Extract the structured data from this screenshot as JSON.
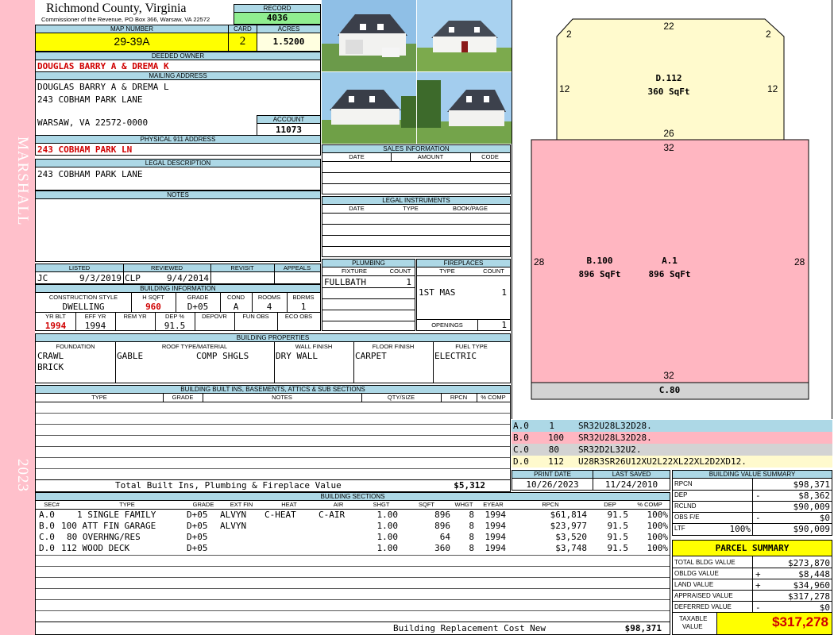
{
  "side_label": "MARSHALL",
  "side_year": "2023",
  "county": "Richmond County, Virginia",
  "commissioner": "Commissioner of the Revenue, PO Box 366, Warsaw, VA 22572",
  "record": {
    "label": "RECORD",
    "value": "4036"
  },
  "map_number": {
    "label": "MAP NUMBER",
    "value": "29-39A"
  },
  "card": {
    "label": "CARD",
    "value": "2"
  },
  "acres": {
    "label": "ACRES",
    "value": "1.5200"
  },
  "deeded_owner": {
    "label": "DEEDED OWNER",
    "value": "DOUGLAS BARRY A & DREMA K"
  },
  "mailing": {
    "label": "MAILING ADDRESS",
    "line1": "DOUGLAS BARRY A & DREMA L",
    "line2": "243 COBHAM PARK LANE",
    "line3": "WARSAW, VA 22572-0000"
  },
  "account": {
    "label": "ACCOUNT",
    "value": "11073"
  },
  "physical": {
    "label": "PHYSICAL 911 ADDRESS",
    "value": "243 COBHAM PARK LN"
  },
  "legal": {
    "label": "LEGAL DESCRIPTION",
    "value": "243 COBHAM PARK LANE"
  },
  "notes": {
    "label": "NOTES"
  },
  "sales": {
    "label": "SALES INFORMATION",
    "cols": [
      "DATE",
      "AMOUNT",
      "CODE"
    ]
  },
  "instruments": {
    "label": "LEGAL INSTRUMENTS",
    "cols": [
      "DATE",
      "TYPE",
      "BOOK/PAGE"
    ]
  },
  "status": {
    "headers": [
      "LISTED",
      "REVIEWED",
      "REVISIT",
      "APPEALS"
    ],
    "listed_by": "JC",
    "listed_date": "9/3/2019",
    "reviewed_by": "CLP",
    "reviewed_date": "9/4/2014"
  },
  "plumbing": {
    "label": "PLUMBING",
    "cols": [
      "FIXTURE",
      "COUNT"
    ],
    "fixture": "FULLBATH",
    "count": "1"
  },
  "fireplaces": {
    "label": "FIREPLACES",
    "cols": [
      "TYPE",
      "COUNT"
    ],
    "type": "1ST MAS",
    "count": "1",
    "openings_label": "OPENINGS",
    "openings": "1"
  },
  "building_info": {
    "label": "BUILDING INFORMATION",
    "cols1": [
      "CONSTRUCTION STYLE",
      "H SQFT",
      "GRADE",
      "COND",
      "ROOMS",
      "BDRMS"
    ],
    "style": "DWELLING",
    "hsqft": "960",
    "grade": "D+05",
    "cond": "A",
    "rooms": "4",
    "bdrms": "1",
    "cols2": [
      "YR BLT",
      "EFF YR",
      "REM YR",
      "DEP %",
      "DEPOVR",
      "FUN OBS",
      "ECO OBS"
    ],
    "yrblt": "1994",
    "effyr": "1994",
    "dep": "91.5"
  },
  "properties": {
    "label": "BUILDING PROPERTIES",
    "cols": [
      "FOUNDATION",
      "ROOF TYPE/MATERIAL",
      "WALL FINISH",
      "FLOOR FINISH",
      "FUEL TYPE"
    ],
    "foundation1": "CRAWL",
    "foundation2": "BRICK",
    "roof_type": "GABLE",
    "roof_material": "COMP SHGLS",
    "wall": "DRY WALL",
    "floor": "CARPET",
    "fuel": "ELECTRIC"
  },
  "builtins": {
    "label": "BUILDING BUILT INS, BASEMENTS, ATTICS & SUB SECTIONS",
    "cols": [
      "TYPE",
      "GRADE",
      "NOTES",
      "QTY/SIZE",
      "RPCN",
      "% COMP"
    ],
    "total_label": "Total Built Ins, Plumbing & Fireplace Value",
    "total_value": "$5,312"
  },
  "sketch": {
    "top_label": "22",
    "corner_left": "2",
    "corner_right": "2",
    "deck_side_left": "12",
    "deck_side_right": "12",
    "deck_name": "D.112",
    "deck_area": "360 SqFt",
    "deck_bottom": "26",
    "main_top": "32",
    "main_left": "28",
    "main_right": "28",
    "main_bottom": "32",
    "b_name": "B.100",
    "b_area": "896 SqFt",
    "a_name": "A.1",
    "a_area": "896 SqFt",
    "c_name": "C.80"
  },
  "legend": [
    {
      "code": "A.0",
      "num": "1",
      "path": "SR32U28L32D28.",
      "color": "#add8e6"
    },
    {
      "code": "B.0",
      "num": "100",
      "path": "SR32U28L32D28.",
      "color": "#ffb6c1"
    },
    {
      "code": "C.0",
      "num": "80",
      "path": "SR32D2L32U2.",
      "color": "#d3d3d3"
    },
    {
      "code": "D.0",
      "num": "112",
      "path": "U28R3SR26U12XU2L22XL22XL2D2XD12.",
      "color": "#fffacd"
    }
  ],
  "print_date": {
    "label": "PRINT DATE",
    "value": "10/26/2023"
  },
  "last_saved": {
    "label": "LAST SAVED",
    "value": "11/24/2010"
  },
  "sections": {
    "label": "BUILDING SECTIONS",
    "cols": [
      "SEC#",
      "TYPE",
      "GRADE",
      "EXT FIN",
      "HEAT",
      "AIR",
      "SHGT",
      "SQFT",
      "WHGT",
      "EYEAR",
      "RPCN",
      "DEP",
      "% COMP"
    ],
    "rows": [
      {
        "sec": "A.0",
        "type": "1 SINGLE FAMILY",
        "grade": "D+05",
        "ext": "ALVYN",
        "heat": "C-HEAT",
        "air": "C-AIR",
        "shgt": "1.00",
        "sqft": "896",
        "whgt": "8",
        "eyear": "1994",
        "rpcn": "$61,814",
        "dep": "91.5",
        "comp": "100%"
      },
      {
        "sec": "B.0",
        "type": "100 ATT FIN GARAGE",
        "grade": "D+05",
        "ext": "ALVYN",
        "heat": "",
        "air": "",
        "shgt": "1.00",
        "sqft": "896",
        "whgt": "8",
        "eyear": "1994",
        "rpcn": "$23,977",
        "dep": "91.5",
        "comp": "100%"
      },
      {
        "sec": "C.0",
        "type": "80 OVERHNG/RES",
        "grade": "D+05",
        "ext": "",
        "heat": "",
        "air": "",
        "shgt": "1.00",
        "sqft": "64",
        "whgt": "8",
        "eyear": "1994",
        "rpcn": "$3,520",
        "dep": "91.5",
        "comp": "100%"
      },
      {
        "sec": "D.0",
        "type": "112 WOOD DECK",
        "grade": "D+05",
        "ext": "",
        "heat": "",
        "air": "",
        "shgt": "1.00",
        "sqft": "360",
        "whgt": "8",
        "eyear": "1994",
        "rpcn": "$3,748",
        "dep": "91.5",
        "comp": "100%"
      }
    ],
    "replacement_label": "Building Replacement Cost New",
    "replacement_value": "$98,371"
  },
  "value_summary": {
    "label": "BUILDING VALUE SUMMARY",
    "rpcn_label": "RPCN",
    "rpcn": "$98,371",
    "dep_label": "DEP",
    "dep_sign": "-",
    "dep": "$8,362",
    "rclnd_label": "RCLND",
    "rclnd": "$90,009",
    "obs_label": "OBS F/E",
    "obs_sign": "-",
    "obs": "$0",
    "ltf_label": "LTF",
    "ltf_pct": "100%",
    "ltf": "$90,009"
  },
  "parcel": {
    "label": "PARCEL SUMMARY",
    "total_bldg_label": "TOTAL BLDG VALUE",
    "total_bldg": "$273,870",
    "obldg_label": "OBLDG VALUE",
    "obldg_sign": "+",
    "obldg": "$8,448",
    "land_label": "LAND VALUE",
    "land_sign": "+",
    "land": "$34,960",
    "appraised_label": "APPRAISED VALUE",
    "appraised": "$317,278",
    "deferred_label": "DEFERRED VALUE",
    "deferred_sign": "-",
    "deferred": "$0",
    "taxable_label1": "TAXABLE",
    "taxable_label2": "VALUE",
    "taxable": "$317,278"
  },
  "colors": {
    "side": "#ffc0cb",
    "header": "#add8e6",
    "yellow": "#ffff00",
    "red": "#d00000",
    "green": "#90ee90"
  }
}
